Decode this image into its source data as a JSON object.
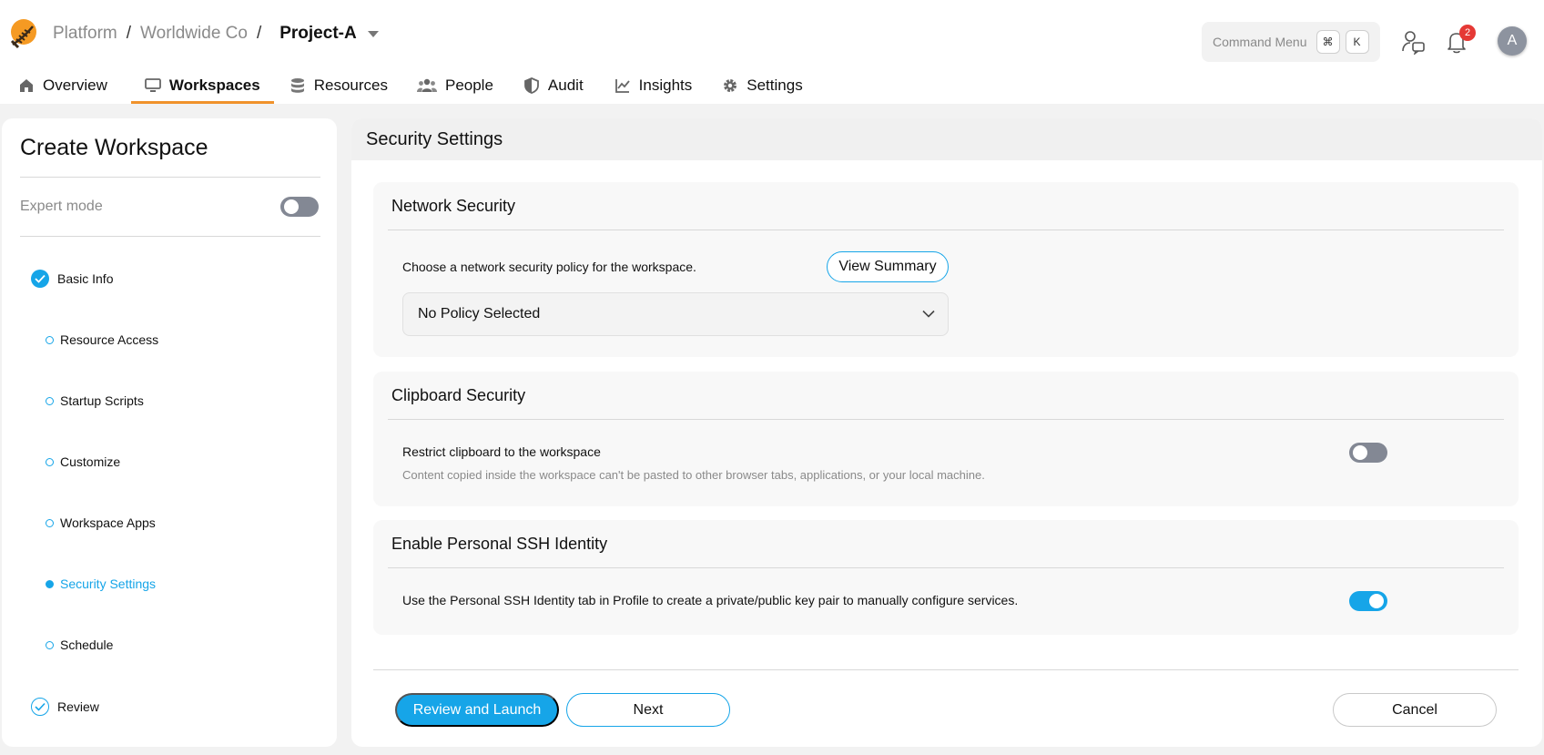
{
  "header": {
    "breadcrumb": [
      "Platform",
      "Worldwide Co",
      "Project-A"
    ],
    "separator": "/",
    "command_menu": {
      "label": "Command Menu",
      "keys": [
        "⌘",
        "K"
      ]
    },
    "notifications_count": "2",
    "avatar_initial": "A",
    "icons": [
      "logo-icon",
      "chevron-down-icon",
      "contact-icon",
      "bell-icon"
    ]
  },
  "tabs": [
    {
      "label": "Overview",
      "icon": "home-icon",
      "active": false
    },
    {
      "label": "Workspaces",
      "icon": "monitor-icon",
      "active": true
    },
    {
      "label": "Resources",
      "icon": "database-icon",
      "active": false
    },
    {
      "label": "People",
      "icon": "people-icon",
      "active": false
    },
    {
      "label": "Audit",
      "icon": "shield-icon",
      "active": false
    },
    {
      "label": "Insights",
      "icon": "chart-icon",
      "active": false
    },
    {
      "label": "Settings",
      "icon": "gear-icon",
      "active": false
    }
  ],
  "sidebar": {
    "title": "Create Workspace",
    "expert_mode_label": "Expert mode",
    "expert_mode_on": false,
    "steps": [
      {
        "label": "Basic Info",
        "state": "complete"
      },
      {
        "label": "Resource Access",
        "state": "pending"
      },
      {
        "label": "Startup Scripts",
        "state": "pending"
      },
      {
        "label": "Customize",
        "state": "pending"
      },
      {
        "label": "Workspace Apps",
        "state": "pending"
      },
      {
        "label": "Security Settings",
        "state": "active"
      },
      {
        "label": "Schedule",
        "state": "pending"
      },
      {
        "label": "Review",
        "state": "review"
      }
    ]
  },
  "main": {
    "title": "Security Settings",
    "network": {
      "title": "Network Security",
      "description": "Choose a network security policy for the workspace.",
      "view_summary_label": "View Summary",
      "policy_value": "No Policy Selected"
    },
    "clipboard": {
      "title": "Clipboard Security",
      "label": "Restrict clipboard to the workspace",
      "description": "Content copied inside the workspace can't be pasted to other browser tabs, applications, or your local machine.",
      "enabled": false
    },
    "ssh": {
      "title": "Enable Personal SSH Identity",
      "description": "Use the Personal SSH Identity tab in Profile to create a private/public key pair to manually configure services.",
      "enabled": true
    }
  },
  "footer": {
    "review_launch_label": "Review and Launch",
    "next_label": "Next",
    "cancel_label": "Cancel"
  },
  "colors": {
    "accent": "#16a5e8",
    "tab_underline": "#f0922b",
    "badge": "#e53935",
    "toggle_off": "#838894"
  }
}
